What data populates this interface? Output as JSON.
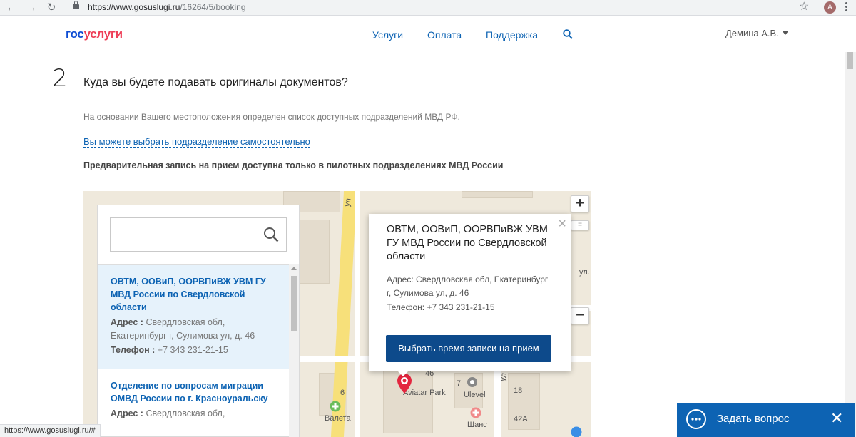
{
  "browser": {
    "url_host": "https://www.gosuslugi.ru",
    "url_path": "/16264/5/booking",
    "profile_initial": "A",
    "status_url": "https://www.gosuslugi.ru/#"
  },
  "header": {
    "logo_part1": "гос",
    "logo_part2": "услуги",
    "nav": [
      "Услуги",
      "Оплата",
      "Поддержка"
    ],
    "user": "Демина А.В."
  },
  "step": {
    "number": "2",
    "title": "Куда вы будете подавать оригиналы документов?",
    "info": "На основании Вашего местоположения определен список доступных подразделений МВД РФ.",
    "self_link": "Вы можете выбрать подразделение самостоятельно",
    "pilot_note": "Предварительная запись на прием доступна только в пилотных подразделениях МВД России"
  },
  "results": [
    {
      "name": "ОВТМ, ООВиП, ООРВПиВЖ УВМ ГУ МВД России по Свердловской области",
      "address_label": "Адрес :",
      "address": "Свердловская обл, Екатеринбург г, Сулимова ул, д. 46",
      "phone_label": "Телефон :",
      "phone": "+7 343 231-21-15"
    },
    {
      "name": "Отделение по вопросам миграции ОМВД России по г. Красноуральску",
      "address_label": "Адрес :",
      "address": "Свердловская обл,"
    }
  ],
  "popup": {
    "title": "ОВТМ, ООВиП, ООРВПиВЖ УВМ ГУ МВД России по Свердловской области",
    "address": "Адрес: Свердловская обл, Екатеринбург г, Сулимова ул, д. 46",
    "phone": "Телефон: +7 343 231-21-15",
    "button": "Выбрать время записи на прием"
  },
  "map_labels": {
    "street_ul1": "ул",
    "street_ul2": "ул.",
    "street_ul3": "ул",
    "n46": "46",
    "n7": "7",
    "n18": "18",
    "n6": "6",
    "n42a": "42А",
    "poi_park": "Aviatar Park",
    "poi_ulevel": "Ulevel",
    "poi_valeta": "Валета",
    "poi_shans": "Шанс"
  },
  "zoom": {
    "plus": "+",
    "minus": "−"
  },
  "chat": {
    "label": "Задать вопрос"
  },
  "colors": {
    "brand_blue": "#0d4cd3",
    "brand_red": "#ee3f58",
    "link_blue": "#0d63b3",
    "button_dark_blue": "#0d4a8b",
    "marker_red": "#e3263f"
  }
}
